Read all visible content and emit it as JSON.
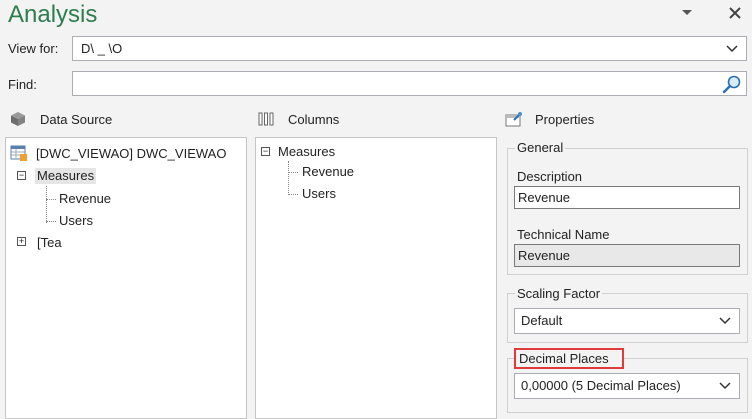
{
  "window": {
    "title": "Analysis",
    "dropdown_icon": "chevron-down-icon",
    "close_icon": "close-icon"
  },
  "view_for": {
    "label": "View for:",
    "value": "D\\    _      \\O"
  },
  "find": {
    "label": "Find:",
    "value": "",
    "icon": "search-icon"
  },
  "data_source": {
    "header": "Data Source",
    "root_label": "[DWC_VIEWAO] DWC_VIEWAO",
    "measures_label": "Measures",
    "measures_children": [
      "Revenue",
      "Users"
    ],
    "dimension_label": "[Tea"
  },
  "columns": {
    "header": "Columns",
    "measures_label": "Measures",
    "measures_children": [
      "Revenue",
      "Users"
    ]
  },
  "properties": {
    "header": "Properties",
    "general": {
      "title": "General",
      "description_label": "Description",
      "description_value": "Revenue",
      "technical_name_label": "Technical Name",
      "technical_name_value": "Revenue"
    },
    "scaling_factor": {
      "title": "Scaling Factor",
      "value": "Default"
    },
    "decimal_places": {
      "title": "Decimal Places",
      "value": "0,00000 (5 Decimal Places)"
    }
  },
  "colors": {
    "title_green": "#2e7d4f",
    "highlight_red": "#e03a3a"
  }
}
